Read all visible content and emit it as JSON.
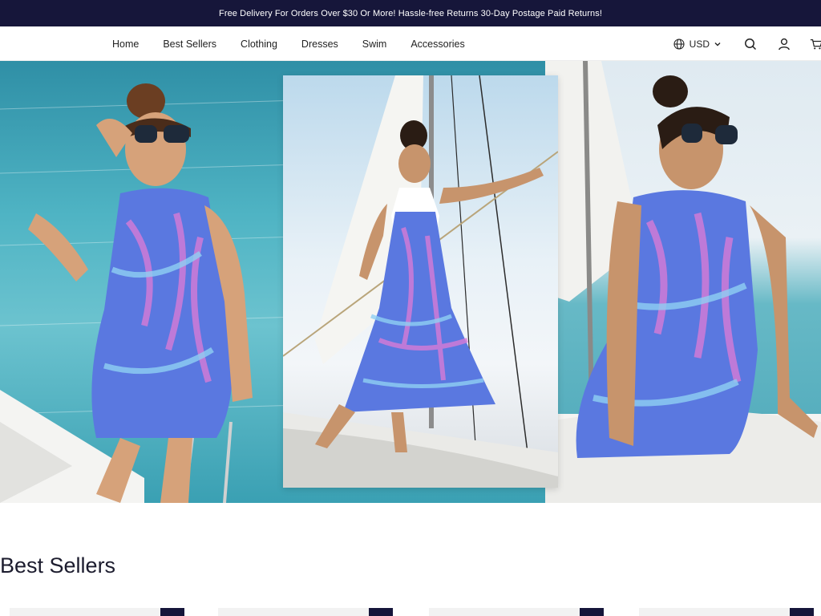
{
  "announcement": "Free Delivery For Orders Over $30 Or More! Hassle-free Returns 30-Day Postage Paid Returns!",
  "nav": {
    "items": [
      {
        "label": "Home"
      },
      {
        "label": "Best Sellers"
      },
      {
        "label": "Clothing"
      },
      {
        "label": "Dresses"
      },
      {
        "label": "Swim"
      },
      {
        "label": "Accessories"
      }
    ]
  },
  "header": {
    "currency": "USD",
    "icons": [
      "globe-icon",
      "chevron-down-icon",
      "search-icon",
      "user-icon",
      "cart-icon"
    ]
  },
  "hero": {
    "panels": [
      "hero-panel-left",
      "hero-panel-middle",
      "hero-panel-right"
    ]
  },
  "best_sellers": {
    "title": "Best Sellers"
  },
  "colors": {
    "brand_dark": "#16163a",
    "text": "#1c1c2e",
    "sea": "#3ea6b8",
    "dress_blue": "#5a78e0",
    "dress_pink": "#d77bd6"
  }
}
